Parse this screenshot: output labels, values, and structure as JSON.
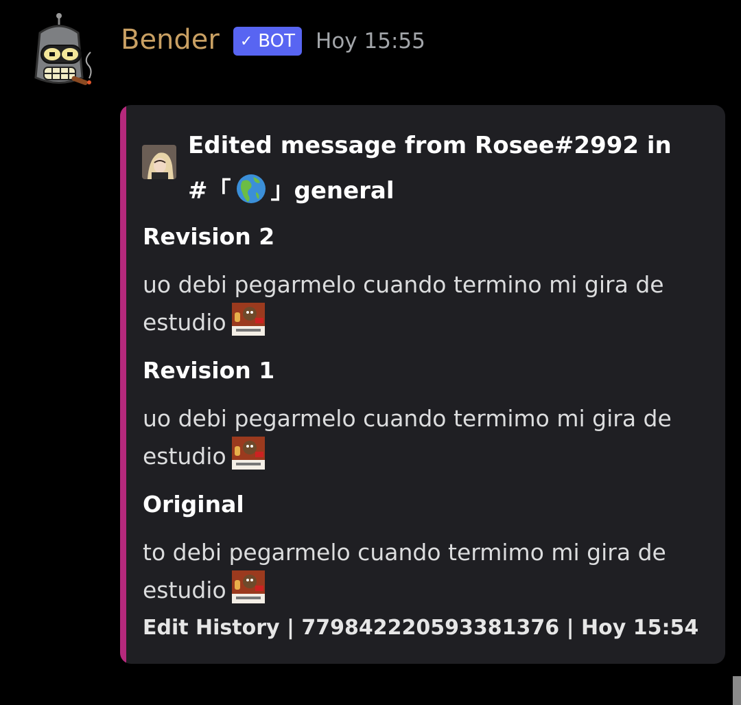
{
  "message": {
    "author": "Bender",
    "bot_tag": "BOT",
    "bot_tag_icon": "checkmark-icon",
    "timestamp": "Hoy 15:55",
    "avatar_icon": "bender-robot-avatar",
    "colors": {
      "username": "#c9a063",
      "bot_tag_bg": "#5865f2",
      "embed_accent": "#b5297c",
      "embed_bg": "#1f1f23"
    }
  },
  "embed": {
    "author_line": "Edited message from Rosee#2992 in",
    "channel_prefix": "#「",
    "channel_suffix": "」general",
    "channel_icon": "globe-americas-icon",
    "fields": [
      {
        "name": "Revision 2",
        "value": "uo debi pegarmelo cuando termino mi gira de estudio",
        "emote": "very-hard-emote"
      },
      {
        "name": "Revision 1",
        "value": "uo debi pegarmelo cuando termimo mi gira de estudio",
        "emote": "very-hard-emote"
      },
      {
        "name": "Original",
        "value": "to debi pegarmelo cuando termimo mi gira de estudio",
        "emote": "very-hard-emote"
      }
    ],
    "footer": "Edit History | 779842220593381376 | Hoy 15:54"
  }
}
